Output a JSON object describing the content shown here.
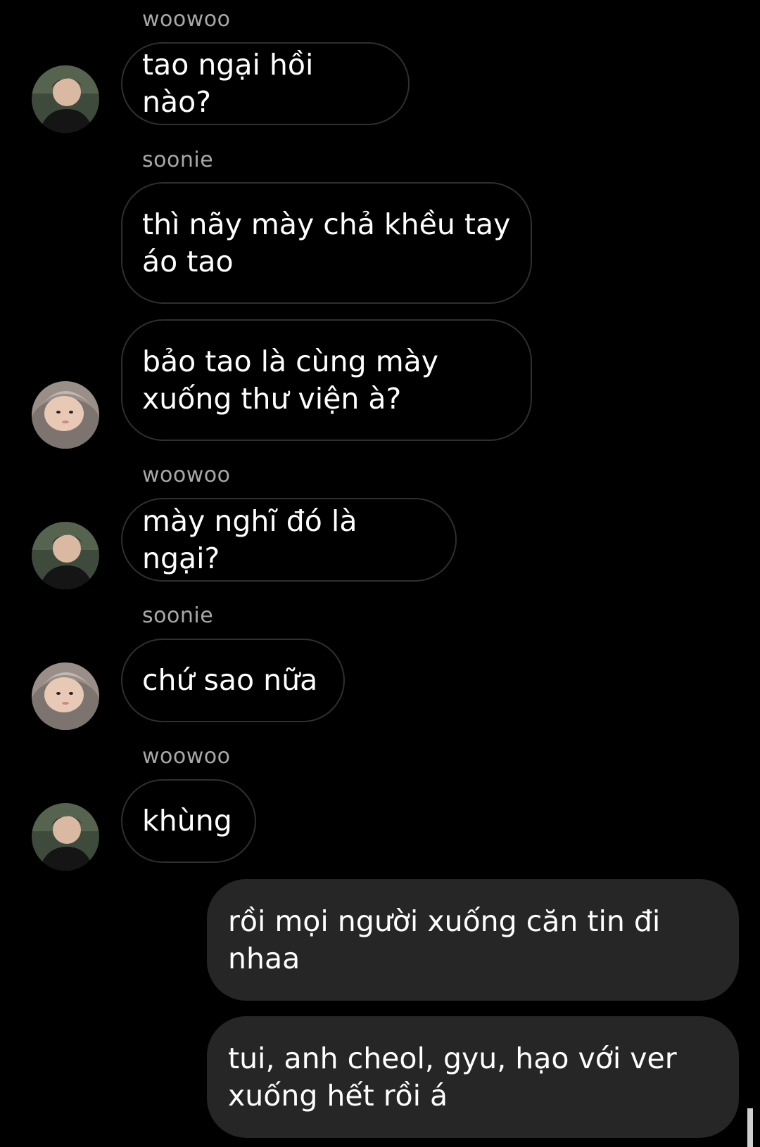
{
  "messages": [
    {
      "sender": "woowoo",
      "text": "tao ngại hồi nào?"
    },
    {
      "sender": "soonie",
      "text": "thì nãy mày chả khều tay áo tao"
    },
    {
      "text": "bảo tao là cùng mày xuống thư viện à?"
    },
    {
      "sender": "woowoo",
      "text": "mày nghĩ đó là ngại?"
    },
    {
      "sender": "soonie",
      "text": "chứ sao nữa"
    },
    {
      "sender": "woowoo",
      "text": "khùng"
    },
    {
      "text": "rồi mọi người xuống căn tin đi nhaa"
    },
    {
      "text": "tui, anh cheol, gyu, hạo với ver xuống hết rồi á"
    }
  ],
  "colors": {
    "background": "#000000",
    "incoming_border": "#2f2f2f",
    "outgoing_bubble": "#262626",
    "sender_label": "#a8a8a8"
  },
  "icons": {
    "avatar_woowoo": "avatar-woowoo-photo",
    "avatar_soonie": "avatar-soonie-photo"
  }
}
